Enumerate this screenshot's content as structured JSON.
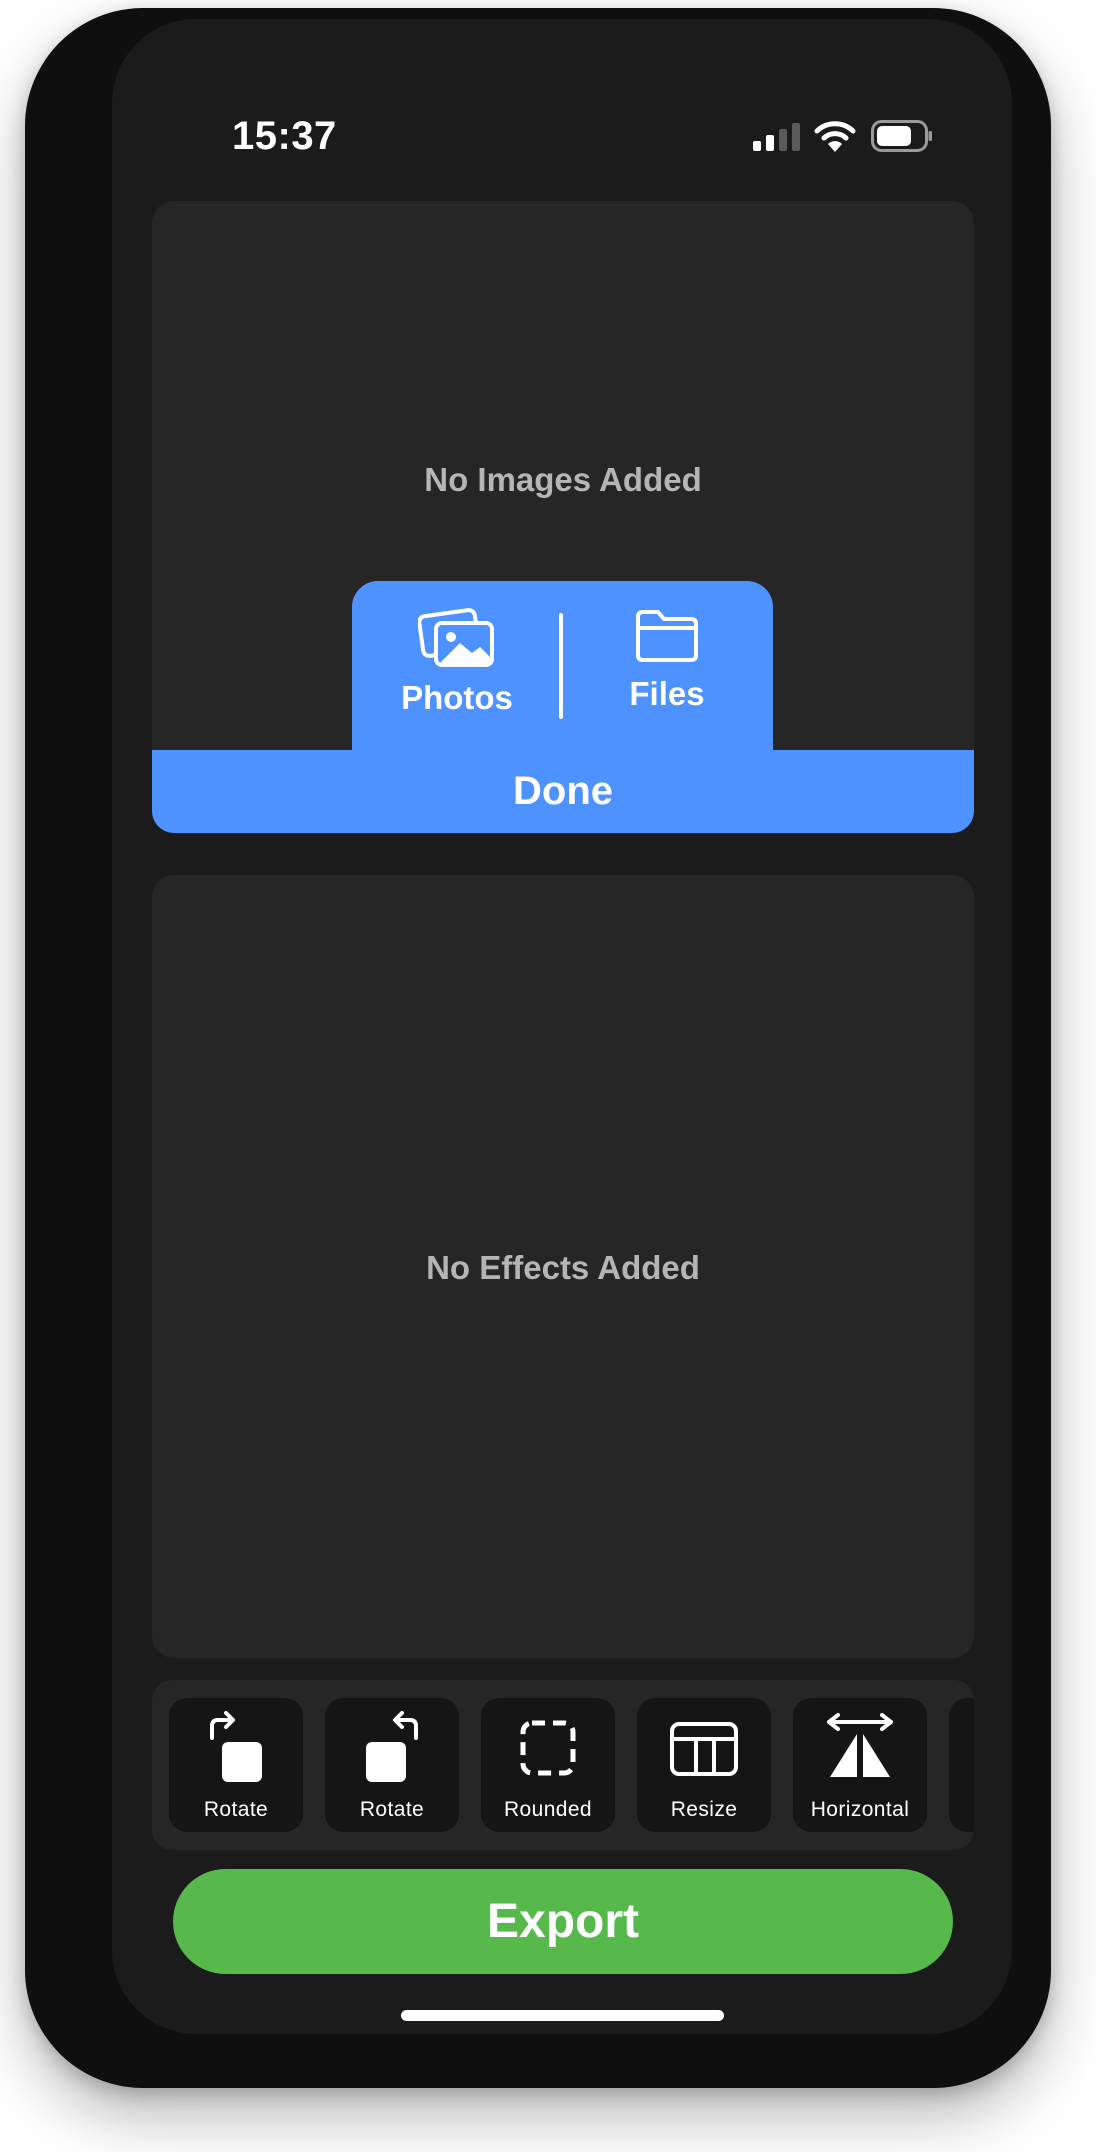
{
  "status_bar": {
    "time": "15:37",
    "icons": [
      "cellular-signal-icon",
      "wifi-icon",
      "battery-icon"
    ]
  },
  "images_panel": {
    "placeholder": "No Images Added"
  },
  "source_picker": {
    "photos": {
      "label": "Photos",
      "icon": "photos-icon"
    },
    "files": {
      "label": "Files",
      "icon": "folder-icon"
    },
    "done_label": "Done"
  },
  "effects_panel": {
    "placeholder": "No Effects Added"
  },
  "tools": [
    {
      "label": "Rotate",
      "icon": "rotate-right-icon"
    },
    {
      "label": "Rotate",
      "icon": "rotate-left-icon"
    },
    {
      "label": "Rounded",
      "icon": "rounded-corners-icon"
    },
    {
      "label": "Resize",
      "icon": "resize-icon"
    },
    {
      "label": "Horizontal",
      "icon": "flip-horizontal-icon"
    }
  ],
  "export_label": "Export",
  "colors": {
    "accent_blue": "#4d92ff",
    "export_green": "#57b84b",
    "panel": "#262626",
    "screen": "#1b1b1b"
  }
}
